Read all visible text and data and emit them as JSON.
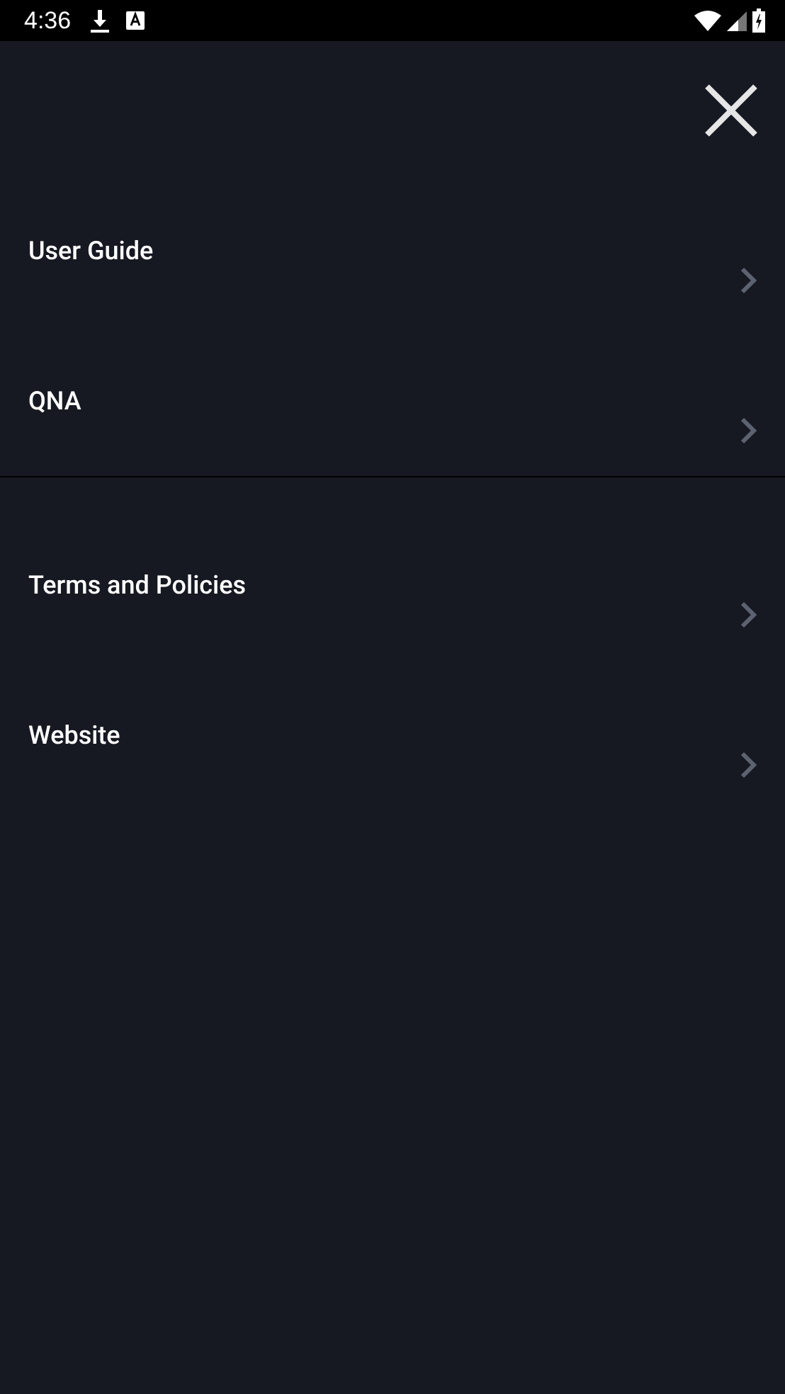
{
  "status_bar": {
    "time": "4:36"
  },
  "menu_groups": [
    {
      "items": [
        {
          "label": "User Guide"
        },
        {
          "label": "QNA"
        }
      ]
    },
    {
      "items": [
        {
          "label": "Terms and Policies"
        },
        {
          "label": "Website"
        }
      ]
    }
  ]
}
